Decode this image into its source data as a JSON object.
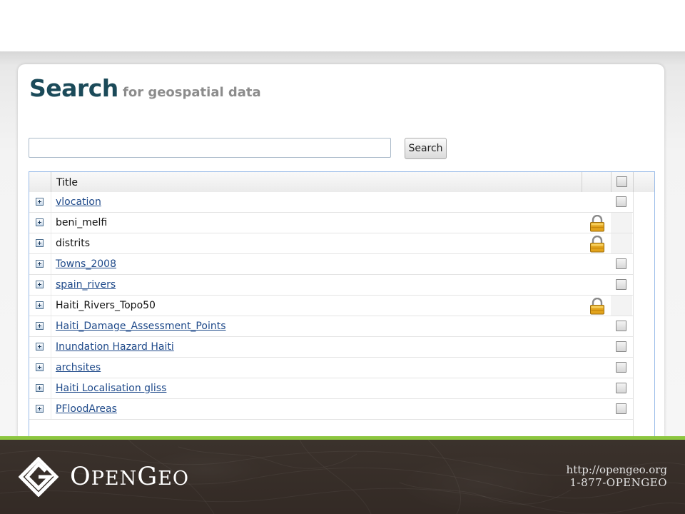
{
  "header": {
    "title": "Search",
    "subtitle": "for geospatial data"
  },
  "search": {
    "value": "",
    "placeholder": "",
    "button_label": "Search"
  },
  "grid": {
    "columns": {
      "title": "Title"
    },
    "rows": [
      {
        "title": "vlocation",
        "link": true,
        "locked": false
      },
      {
        "title": "beni_melfi",
        "link": false,
        "locked": true
      },
      {
        "title": "distrits",
        "link": false,
        "locked": true
      },
      {
        "title": "Towns_2008",
        "link": true,
        "locked": false
      },
      {
        "title": "spain_rivers",
        "link": true,
        "locked": false
      },
      {
        "title": "Haiti_Rivers_Topo50",
        "link": false,
        "locked": true
      },
      {
        "title": "Haiti_Damage_Assessment_Points",
        "link": true,
        "locked": false
      },
      {
        "title": "Inundation Hazard Haiti",
        "link": true,
        "locked": false
      },
      {
        "title": "archsites",
        "link": true,
        "locked": false
      },
      {
        "title": "Haiti Localisation gliss",
        "link": true,
        "locked": false
      },
      {
        "title": "PFloodAreas",
        "link": true,
        "locked": false
      }
    ]
  },
  "footer": {
    "logo_text_cap1": "O",
    "logo_text_rest1": "PEN",
    "logo_text_cap2": "G",
    "logo_text_rest2": "EO",
    "url": "http://opengeo.org",
    "phone": "1-877-OPENGEO"
  },
  "colors": {
    "title": "#1b4a59",
    "accent_green": "#8cc63f",
    "footer_bg": "#3a302b",
    "link": "#1f4a8a"
  }
}
